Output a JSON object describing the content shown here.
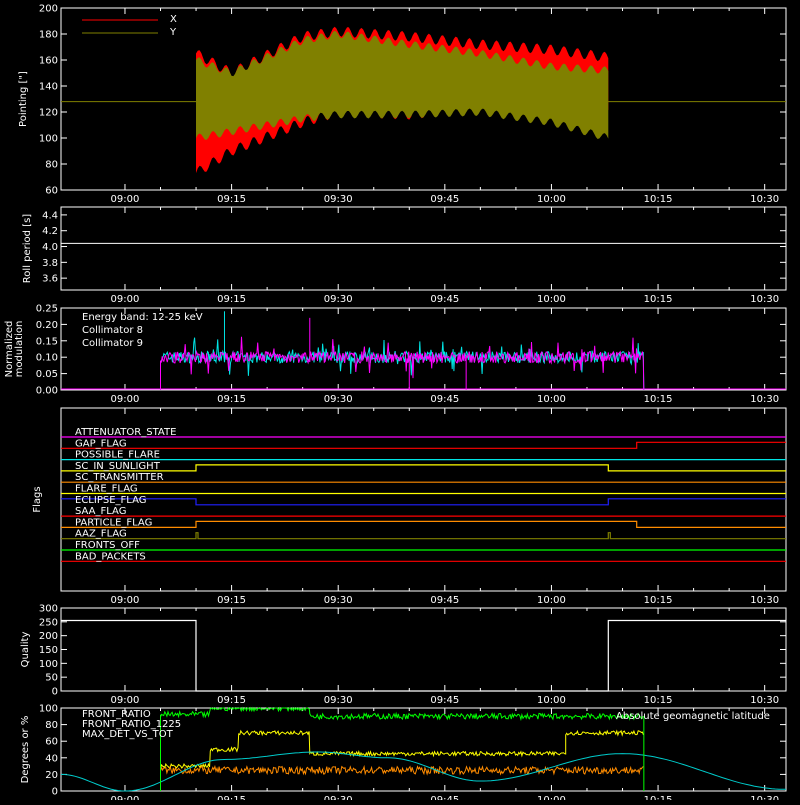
{
  "colors": {
    "x": "#ff0000",
    "y": "#808000",
    "white": "#ffffff",
    "coll8": "#00e5e5",
    "coll9": "#ff00ff",
    "front_ratio": "#ffff00",
    "front_ratio_1225": "#00ff00",
    "max_det": "#ff8c00",
    "latitude": "#00cccc"
  },
  "time_axis": {
    "tick_labels": [
      "09:00",
      "09:15",
      "09:30",
      "09:45",
      "10:00",
      "10:15",
      "10:30"
    ],
    "start": "08:51",
    "end": "10:33"
  },
  "chart_data": [
    {
      "type": "area",
      "ylabel": "Pointing [\"]",
      "ylim": [
        60,
        200
      ],
      "yticks": [
        60,
        80,
        100,
        120,
        140,
        160,
        180,
        200
      ],
      "legend": [
        "X",
        "Y"
      ],
      "baseline": 128,
      "data_start": "09:10",
      "data_end": "10:08",
      "series": [
        {
          "name": "X",
          "upper_x": [
            "09:10",
            "09:15",
            "09:25",
            "09:30",
            "09:40",
            "09:50",
            "10:00",
            "10:08"
          ],
          "upper_y": [
            165,
            150,
            178,
            182,
            178,
            172,
            168,
            162
          ],
          "lower_y": [
            73,
            90,
            112,
            120,
            118,
            124,
            128,
            122
          ]
        },
        {
          "name": "Y",
          "upper_x": [
            "09:10",
            "09:15",
            "09:25",
            "09:30",
            "09:40",
            "09:50",
            "10:00",
            "10:08"
          ],
          "upper_y": [
            160,
            150,
            175,
            180,
            172,
            165,
            155,
            152
          ],
          "lower_y": [
            100,
            105,
            115,
            118,
            118,
            120,
            112,
            100
          ]
        }
      ]
    },
    {
      "type": "line",
      "ylabel": "Roll period [s]",
      "ylim": [
        3.45,
        4.5
      ],
      "yticks": [
        3.6,
        3.8,
        4.0,
        4.2,
        4.4
      ],
      "series": [
        {
          "name": "",
          "x": [
            "08:51",
            "10:33"
          ],
          "y": [
            4.04,
            4.04
          ]
        }
      ]
    },
    {
      "type": "line",
      "ylabel": "Normalized modulation",
      "ylim": [
        0,
        0.25
      ],
      "yticks": [
        0.0,
        0.05,
        0.1,
        0.15,
        0.2,
        0.25
      ],
      "annotations": [
        "Energy band: 12-25 keV"
      ],
      "legend": [
        "Collimator 8",
        "Collimator 9"
      ],
      "data_start": "09:05",
      "data_end": "10:13",
      "series": [
        {
          "name": "Collimator 8",
          "level": 0.1
        },
        {
          "name": "Collimator 9",
          "level": 0.1
        }
      ]
    },
    {
      "type": "line",
      "ylabel": "Flags",
      "flags": [
        {
          "name": "ATTENUATOR_STATE",
          "color": "#ff00ff",
          "changes": []
        },
        {
          "name": "GAP_FLAG",
          "color": "#ff0000",
          "changes": [
            "10:12"
          ]
        },
        {
          "name": "POSSIBLE_FLARE",
          "color": "#00e5e5",
          "changes": []
        },
        {
          "name": "SC_IN_SUNLIGHT",
          "color": "#ffff00",
          "changes": [
            "09:10",
            "10:08"
          ]
        },
        {
          "name": "SC_TRANSMITTER",
          "color": "#ff8c00",
          "changes": []
        },
        {
          "name": "FLARE_FLAG",
          "color": "#ffff00",
          "changes": []
        },
        {
          "name": "ECLIPSE_FLAG",
          "color": "#2020ff",
          "changes": [
            "09:10",
            "10:08"
          ]
        },
        {
          "name": "SAA_FLAG",
          "color": "#ff0000",
          "changes": []
        },
        {
          "name": "PARTICLE_FLAG",
          "color": "#ff8c00",
          "changes": [
            "09:10",
            "10:12"
          ]
        },
        {
          "name": "AAZ_FLAG",
          "color": "#808000",
          "changes": [
            "09:10",
            "10:08"
          ]
        },
        {
          "name": "FRONTS_OFF",
          "color": "#00ff00",
          "changes": []
        },
        {
          "name": "BAD_PACKETS",
          "color": "#ff0000",
          "changes": []
        }
      ]
    },
    {
      "type": "line",
      "ylabel": "Quality",
      "ylim": [
        0,
        300
      ],
      "yticks": [
        0,
        50,
        100,
        150,
        200,
        250,
        300
      ],
      "series": [
        {
          "name": "",
          "x": [
            "08:51",
            "09:10",
            "09:10",
            "10:08",
            "10:08",
            "10:33"
          ],
          "y": [
            255,
            255,
            0,
            0,
            255,
            255
          ]
        }
      ]
    },
    {
      "type": "line",
      "ylabel": "Degrees or %",
      "ylim": [
        0,
        100
      ],
      "yticks": [
        0,
        20,
        40,
        60,
        80,
        100
      ],
      "legend": [
        "FRONT_RATIO",
        "FRONT_RATIO_1225",
        "MAX_DET_VS_TOT"
      ],
      "annotations": [
        "Absolute geomagnetic latitude"
      ],
      "series": [
        {
          "name": "FRONT_RATIO",
          "x": [
            "09:05",
            "09:12",
            "09:12",
            "09:16",
            "09:16",
            "09:26",
            "09:26",
            "10:02",
            "10:02",
            "10:13"
          ],
          "y": [
            30,
            30,
            50,
            50,
            70,
            70,
            45,
            45,
            70,
            70
          ]
        },
        {
          "name": "FRONT_RATIO_1225",
          "x": [
            "09:05",
            "09:12",
            "09:12",
            "09:26",
            "09:26",
            "10:13"
          ],
          "y": [
            92,
            92,
            100,
            100,
            90,
            90
          ]
        },
        {
          "name": "MAX_DET_VS_TOT",
          "x": [
            "09:05",
            "10:13"
          ],
          "y": [
            25,
            25
          ]
        },
        {
          "name": "Absolute geomagnetic latitude",
          "x": [
            "08:51",
            "09:00",
            "09:14",
            "09:27",
            "09:37",
            "09:50",
            "10:10",
            "10:33"
          ],
          "y": [
            20,
            0,
            38,
            47,
            40,
            12,
            45,
            2
          ]
        }
      ]
    }
  ]
}
